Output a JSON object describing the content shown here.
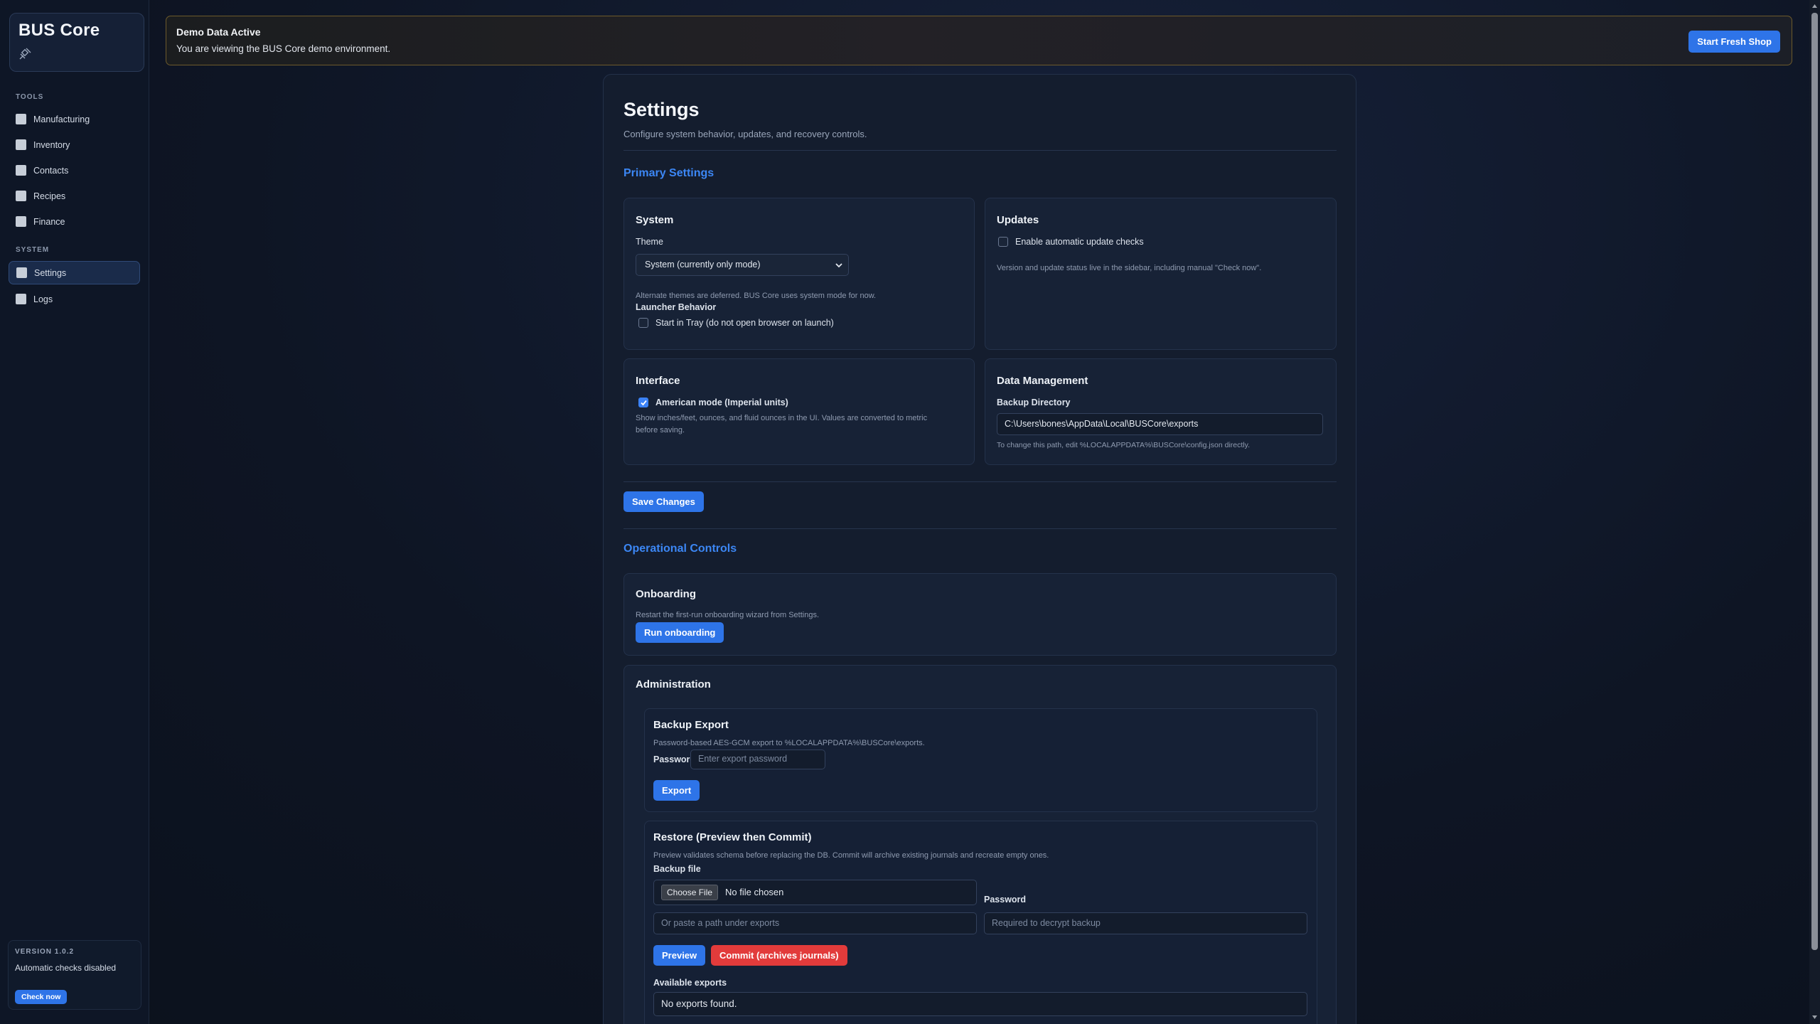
{
  "app": {
    "brand": "BUS Core"
  },
  "sidebar": {
    "tools_label": "TOOLS",
    "system_label": "SYSTEM",
    "tools": [
      {
        "label": "Manufacturing"
      },
      {
        "label": "Inventory"
      },
      {
        "label": "Contacts"
      },
      {
        "label": "Recipes"
      },
      {
        "label": "Finance"
      }
    ],
    "system": [
      {
        "label": "Settings",
        "active": true
      },
      {
        "label": "Logs"
      }
    ],
    "version": {
      "label": "VERSION 1.0.2",
      "status": "Automatic checks disabled",
      "check_now": "Check now"
    }
  },
  "banner": {
    "title": "Demo Data Active",
    "subtitle": "You are viewing the BUS Core demo environment.",
    "button": "Start Fresh Shop"
  },
  "settings": {
    "title": "Settings",
    "subtitle": "Configure system behavior, updates, and recovery controls.",
    "primary_title": "Primary Settings",
    "system": {
      "title": "System",
      "theme_label": "Theme",
      "theme_value": "System (currently only mode)",
      "theme_help": "Alternate themes are deferred. BUS Core uses system mode for now.",
      "launcher_label": "Launcher Behavior",
      "tray_label": "Start in Tray (do not open browser on launch)",
      "tray_checked": false
    },
    "updates": {
      "title": "Updates",
      "auto_label": "Enable automatic update checks",
      "auto_checked": false,
      "help": "Version and update status live in the sidebar, including manual \"Check now\"."
    },
    "interface": {
      "title": "Interface",
      "american_label": "American mode (Imperial units)",
      "american_checked": true,
      "help_line1": "Show inches/feet, ounces, and fluid ounces in the UI. Values are converted to metric",
      "help_line2": "before saving."
    },
    "data_management": {
      "title": "Data Management",
      "backup_dir_label": "Backup Directory",
      "backup_dir_value": "C:\\Users\\bones\\AppData\\Local\\BUSCore\\exports",
      "help": "To change this path, edit %LOCALAPPDATA%\\BUSCore\\config.json directly."
    },
    "save_button": "Save Changes",
    "operational_title": "Operational Controls",
    "onboarding": {
      "title": "Onboarding",
      "help": "Restart the first-run onboarding wizard from Settings.",
      "button": "Run onboarding"
    },
    "administration": {
      "title": "Administration",
      "backup_export": {
        "title": "Backup Export",
        "help": "Password-based AES-GCM export to %LOCALAPPDATA%\\BUSCore\\exports.",
        "password_label": "Password",
        "password_placeholder": "Enter export password",
        "button": "Export"
      },
      "restore": {
        "title": "Restore (Preview then Commit)",
        "help": "Preview validates schema before replacing the DB. Commit will archive existing journals and recreate empty ones.",
        "backup_file_label": "Backup file",
        "choose_file": "Choose File",
        "no_file": "No file chosen",
        "path_placeholder": "Or paste a path under exports",
        "password_label": "Password",
        "password_placeholder": "Required to decrypt backup",
        "preview_button": "Preview",
        "commit_button": "Commit (archives journals)",
        "available_label": "Available exports",
        "none_found": "No exports found."
      }
    }
  }
}
